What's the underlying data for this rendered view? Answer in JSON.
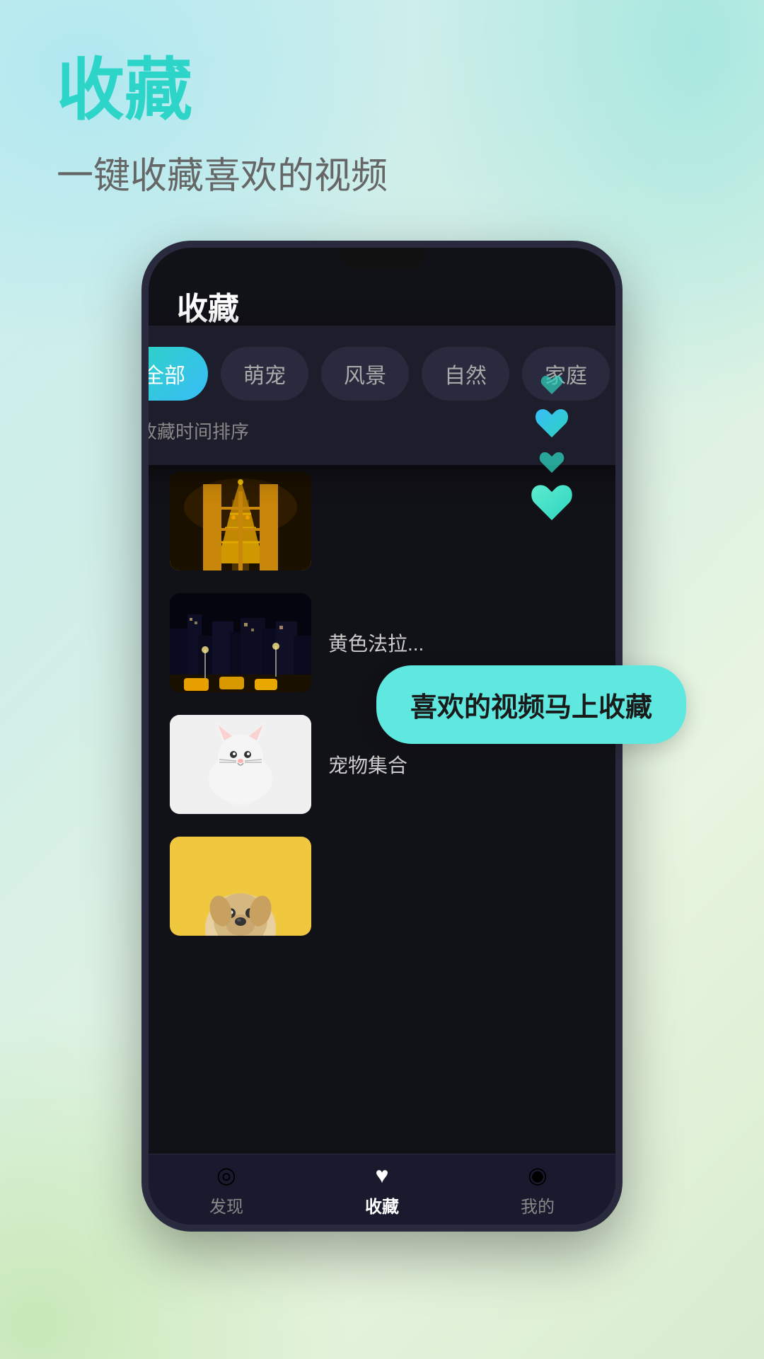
{
  "page": {
    "title": "收藏",
    "subtitle": "一键收藏喜欢的视频",
    "background_gradient": "linear-gradient(135deg, #c8eef0, #d0eee8, #e8f5e0, #d8ecd0)"
  },
  "phone": {
    "app_title": "收藏",
    "filter": {
      "sort_label": "按收藏时间排序",
      "tabs": [
        {
          "id": "all",
          "label": "全部",
          "active": true
        },
        {
          "id": "pets",
          "label": "萌宠",
          "active": false
        },
        {
          "id": "scenery",
          "label": "风景",
          "active": false
        },
        {
          "id": "nature",
          "label": "自然",
          "active": false
        },
        {
          "id": "family",
          "label": "家庭",
          "active": false
        }
      ]
    },
    "videos": [
      {
        "id": 1,
        "title": "",
        "thumb_type": "eiffel"
      },
      {
        "id": 2,
        "title": "黄色法拉...",
        "thumb_type": "city"
      },
      {
        "id": 3,
        "title": "宠物集合",
        "thumb_type": "cat"
      },
      {
        "id": 4,
        "title": "",
        "thumb_type": "dog"
      }
    ],
    "tooltip": "喜欢的视频马上收藏",
    "bottom_nav": [
      {
        "id": "discover",
        "label": "发现",
        "icon": "◎",
        "active": false
      },
      {
        "id": "collection",
        "label": "收藏",
        "icon": "♥",
        "active": true
      },
      {
        "id": "mine",
        "label": "我的",
        "icon": "◉",
        "active": false
      }
    ]
  }
}
